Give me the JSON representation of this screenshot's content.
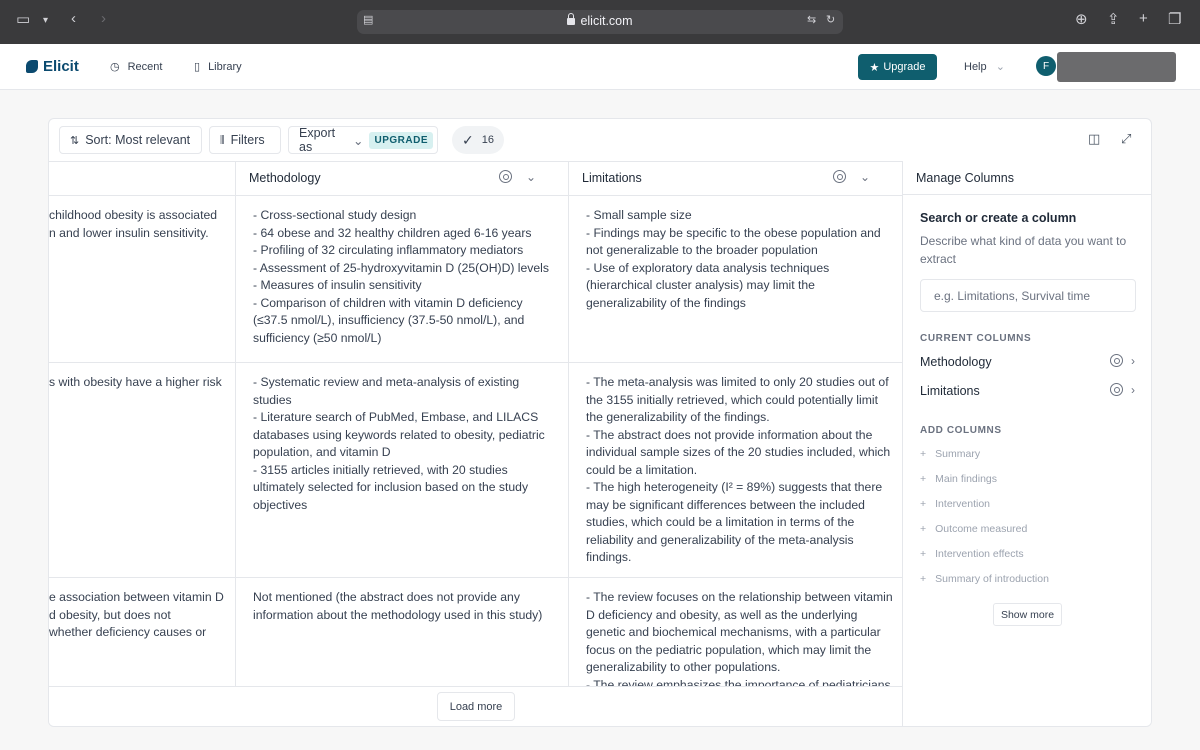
{
  "browser": {
    "url": "elicit.com",
    "icons": [
      "sidebar-icon",
      "chevron-down-icon",
      "back-icon",
      "forward-icon",
      "page-icon",
      "lock-icon",
      "translate-icon",
      "reload-icon",
      "download-icon",
      "share-icon",
      "new-tab-icon",
      "tabs-icon"
    ]
  },
  "header": {
    "brand": "Elicit",
    "nav": [
      {
        "label": "Recent",
        "icon": "clock-icon"
      },
      {
        "label": "Library",
        "icon": "book-icon"
      }
    ],
    "upgrade_label": "Upgrade",
    "help_label": "Help",
    "avatar_initial": "F"
  },
  "toolbar": {
    "sort_label": "Sort: Most relevant",
    "filters_label": "Filters",
    "export_label": "Export as",
    "export_badge": "UPGRADE",
    "selected_count": "16"
  },
  "table": {
    "columns": [
      {
        "label": "Methodology"
      },
      {
        "label": "Limitations"
      }
    ],
    "rows": [
      {
        "summary": "childhood obesity is associated\nn and lower insulin sensitivity.",
        "methodology": "- Cross-sectional study design\n- 64 obese and 32 healthy children aged 6-16 years\n- Profiling of 32 circulating inflammatory mediators\n- Assessment of 25-hydroxyvitamin D (25(OH)D) levels\n- Measures of insulin sensitivity\n- Comparison of children with vitamin D deficiency\n(≤37.5 nmol/L), insufficiency (37.5-50 nmol/L), and\nsufficiency (≥50 nmol/L)",
        "limitations": "- Small sample size\n- Findings may be specific to the obese population and\nnot generalizable to the broader population\n- Use of exploratory data analysis techniques\n(hierarchical cluster analysis) may limit the\ngeneralizability of the findings"
      },
      {
        "summary": "s with obesity have a higher risk",
        "methodology": "- Systematic review and meta-analysis of existing\nstudies\n- Literature search of PubMed, Embase, and LILACS\ndatabases using keywords related to obesity, pediatric\npopulation, and vitamin D\n- 3155 articles initially retrieved, with 20 studies\nultimately selected for inclusion based on the study\nobjectives",
        "limitations": "- The meta-analysis was limited to only 20 studies out of\nthe 3155 initially retrieved, which could potentially limit\nthe generalizability of the findings.\n- The abstract does not provide information about the\nindividual sample sizes of the 20 studies included, which\ncould be a limitation.\n- The high heterogeneity (I² = 89%) suggests that there\nmay be significant differences between the included\nstudies, which could be a limitation in terms of the\nreliability and generalizability of the meta-analysis\nfindings."
      },
      {
        "summary": "e association between vitamin D\nd obesity, but does not\nwhether deficiency causes or",
        "methodology": "Not mentioned (the abstract does not provide any\ninformation about the methodology used in this study)",
        "limitations": "- The review focuses on the relationship between vitamin\nD deficiency and obesity, as well as the underlying\ngenetic and biochemical mechanisms, with a particular\nfocus on the pediatric population, which may limit the\ngeneralizability to other populations.\n- The review emphasizes the importance of pediatricians"
      }
    ],
    "load_more_label": "Load more"
  },
  "panel": {
    "title": "Manage Columns",
    "search_title": "Search or create a column",
    "search_desc": "Describe what kind of data you want to extract",
    "search_placeholder": "e.g. Limitations, Survival time",
    "current_label": "CURRENT COLUMNS",
    "current_columns": [
      "Methodology",
      "Limitations"
    ],
    "add_label": "ADD COLUMNS",
    "add_columns": [
      "Summary",
      "Main findings",
      "Intervention",
      "Outcome measured",
      "Intervention effects",
      "Summary of introduction"
    ],
    "show_more_label": "Show more"
  },
  "colors": {
    "accent": "#0f5e6e",
    "brand": "#0b4a6f",
    "chrome": "#3a3a3c"
  }
}
